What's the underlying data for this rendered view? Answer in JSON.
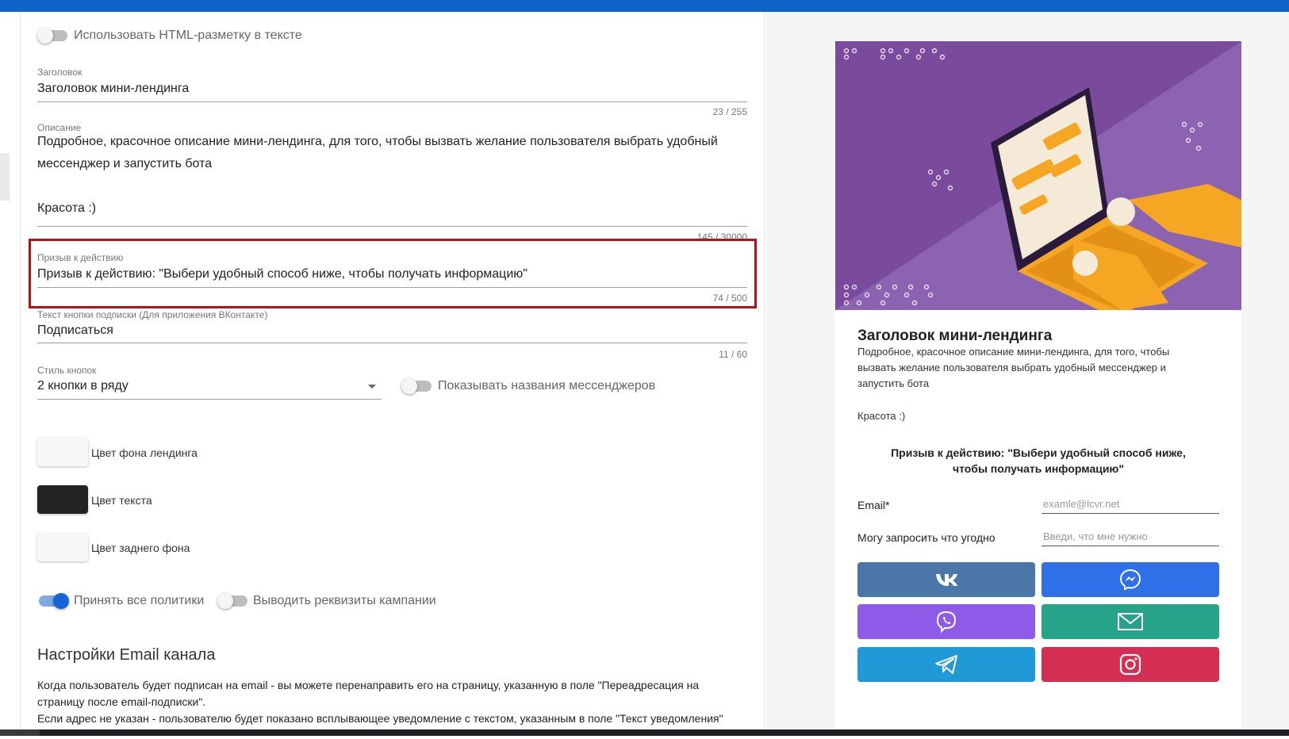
{
  "form": {
    "html_toggle": {
      "label": "Использовать HTML-разметку в тексте",
      "on": false
    },
    "title_field": {
      "label": "Заголовок",
      "value": "Заголовок мини-лендинга",
      "counter": "23 / 255"
    },
    "description_field": {
      "label": "Описание",
      "line1": "Подробное, красочное описание мини-лендинга, для того, чтобы вызвать желание пользователя выбрать удобный",
      "line2": "мессенджер и запустить бота",
      "line3": "Красота :)",
      "counter": "145 / 30000"
    },
    "cta_field": {
      "label": "Призыв к действию",
      "value": "Призыв к действию: \"Выбери удобный способ ниже, чтобы получать информацию\"",
      "counter": "74 / 500"
    },
    "subscribe_field": {
      "label": "Текст кнопки подписки (Для приложения ВКонтакте)",
      "value": "Подписаться",
      "counter": "11 / 60"
    },
    "button_style": {
      "label": "Стиль кнопок",
      "value": "2 кнопки в ряду"
    },
    "show_names_toggle": {
      "label": "Показывать названия мессенджеров",
      "on": false
    },
    "colors": [
      {
        "label": "Цвет фона лендинга",
        "color": "#f7f7f7"
      },
      {
        "label": "Цвет текста",
        "color": "#232323"
      },
      {
        "label": "Цвет заднего фона",
        "color": "#f7f7f7"
      }
    ],
    "accept_policies_toggle": {
      "label": "Принять все политики",
      "on": true
    },
    "show_requisites_toggle": {
      "label": "Выводить реквизиты кампании",
      "on": false
    },
    "email_section": {
      "title": "Настройки Email канала",
      "line1": "Когда пользователь будет подписан на email - вы можете перенаправить его на страницу, указанную в поле \"Переадресация на",
      "line2": "страницу после email-подписки\".",
      "line3": "Если адрес не указан - пользователю будет показано всплывающее уведомление с текстом, указанным в поле \"Текст уведомления\""
    }
  },
  "preview": {
    "title": "Заголовок мини-лендинга",
    "desc_line1": "Подробное, красочное описание мини-лендинга, для того, чтобы",
    "desc_line2": "вызвать желание пользователя выбрать удобный мессенджер и",
    "desc_line3": "запустить бота",
    "desc_line4": "Красота :)",
    "cta_line1": "Призыв к действию: \"Выбери удобный способ ниже,",
    "cta_line2": "чтобы получать информацию\"",
    "email_label": "Email*",
    "email_placeholder": "examle@lcvr.net",
    "request_label": "Могу запросить что угодно",
    "request_placeholder": "Введи, что мне нужно",
    "buttons": [
      {
        "name": "vk",
        "icon": "vk-icon",
        "color": "#4a76a8"
      },
      {
        "name": "messenger",
        "icon": "messenger-icon",
        "color": "#2f6fe8"
      },
      {
        "name": "viber",
        "icon": "viber-icon",
        "color": "#8e5ce8"
      },
      {
        "name": "email",
        "icon": "mail-icon",
        "color": "#27a38a"
      },
      {
        "name": "telegram",
        "icon": "telegram-icon",
        "color": "#1f9ad6"
      },
      {
        "name": "instagram",
        "icon": "instagram-icon",
        "color": "#d42e52"
      }
    ]
  }
}
